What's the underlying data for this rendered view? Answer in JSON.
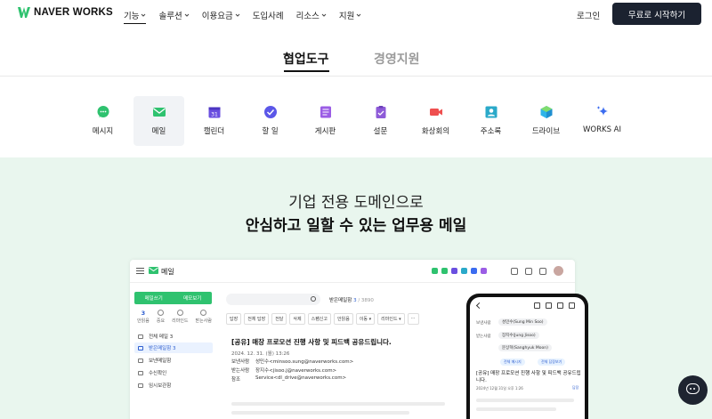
{
  "header": {
    "brand": "NAVER WORKS",
    "nav": [
      {
        "label": "기능",
        "dropdown": true,
        "active": true
      },
      {
        "label": "솔루션",
        "dropdown": true
      },
      {
        "label": "이용요금",
        "dropdown": true
      },
      {
        "label": "도입사례",
        "dropdown": false
      },
      {
        "label": "리소스",
        "dropdown": true
      },
      {
        "label": "지원",
        "dropdown": true
      }
    ],
    "login": "로그인",
    "cta": "무료로 시작하기",
    "cta_color": "#1b2230"
  },
  "tabs": {
    "active": "협업도구",
    "inactive": "경영지원"
  },
  "features": [
    {
      "label": "메시지",
      "icon": "message-icon",
      "color": "#2fc26f"
    },
    {
      "label": "메일",
      "icon": "mail-icon",
      "color": "#2fc26f",
      "selected": true
    },
    {
      "label": "캘린더",
      "icon": "calendar-icon",
      "color": "#6a4fe0"
    },
    {
      "label": "할 일",
      "icon": "task-icon",
      "color": "#5b57e8"
    },
    {
      "label": "게시판",
      "icon": "board-icon",
      "color": "#9b5de5"
    },
    {
      "label": "설문",
      "icon": "survey-icon",
      "color": "#8e5bd8"
    },
    {
      "label": "화상회의",
      "icon": "video-icon",
      "color": "#ef4f4f"
    },
    {
      "label": "주소록",
      "icon": "contacts-icon",
      "color": "#2aa9c9"
    },
    {
      "label": "드라이브",
      "icon": "drive-icon",
      "color": "#2fb4e8"
    },
    {
      "label": "WORKS AI",
      "icon": "sparkle-icon",
      "color": "#3b6cf0"
    }
  ],
  "hero": {
    "line1": "기업 전용 도메인으로",
    "line2": "안심하고 일할 수 있는 업무용 메일",
    "background": "#e9f6ee"
  },
  "app": {
    "title": "메일",
    "write_button": "메일쓰기",
    "self_button": "메모보기",
    "counters": [
      {
        "value": "3",
        "label": "안읽음"
      },
      {
        "value": "",
        "label": "중요"
      },
      {
        "value": "",
        "label": "리마인드"
      },
      {
        "value": "",
        "label": "받는사람"
      }
    ],
    "folders": [
      {
        "label": "전체 메일 3",
        "selected": false
      },
      {
        "label": "받은메일함 3",
        "selected": true
      },
      {
        "label": "보낸메일함",
        "selected": false
      },
      {
        "label": "수신확인",
        "selected": false
      },
      {
        "label": "임시보관함",
        "selected": false
      }
    ],
    "inbox_title": "받은메일함",
    "inbox_count": "3",
    "inbox_total": "/ 3890",
    "toolbar": [
      "답장",
      "전체 답장",
      "전달",
      "삭제",
      "스팸신고",
      "안읽음",
      "이동 ▾",
      "리마인드 ▾",
      "⋯"
    ],
    "mail": {
      "subject": "[공유] 매장 프로모션 진행 사항 및 피드백 공유드립니다.",
      "date": "2024. 12. 31. (월) 13:26",
      "from_label": "보낸사람",
      "from_value": "성민수<minsoo.sung@naverworks.com>",
      "to_label": "받는사람",
      "to_value": "장지수<jisoo.j@naverworks.com>",
      "cc_label": "참조",
      "cc_value": "Service<dl_drive@naverworks.com>"
    }
  },
  "phone": {
    "from_label": "보낸사람",
    "from_chip": "성민수(Sung Min Soo)",
    "to_label": "받는사람",
    "to_chip1": "장지수(Jung Jisoo)",
    "to_chip2": "문상혁(Sanghyuk Moon)",
    "subject": "[공유] 매장 프로모션 진행 사항 및 피드백 공유드립니다.",
    "date": "2024년 12월 31일 오후 1:26",
    "reply": "답장",
    "chip_msg": "전체 메시지",
    "chip_more": "전체 답장보기"
  }
}
